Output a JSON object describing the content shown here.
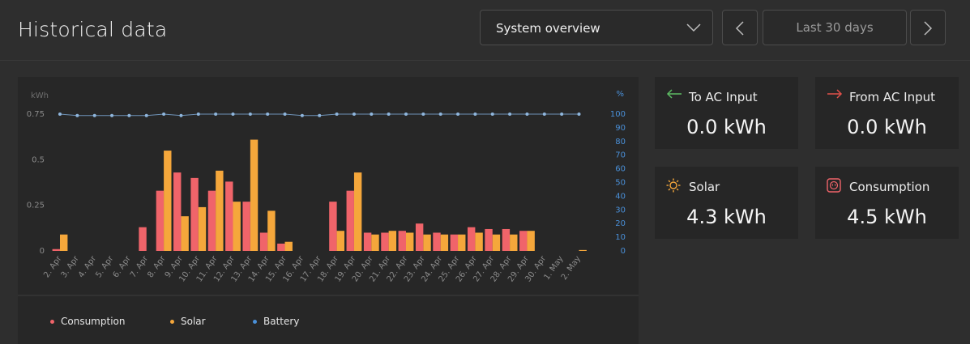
{
  "header": {
    "title": "Historical data",
    "view_select": "System overview",
    "range_label": "Last 30 days"
  },
  "colors": {
    "consumption": "#f0646a",
    "solar": "#f5a73b",
    "battery": "#4a90d9",
    "grid_import": "#5dbb63",
    "grid_export": "#e0504a"
  },
  "icons": {
    "select": "chevron-down-icon",
    "prev": "chevron-left-icon",
    "next": "chevron-right-icon",
    "to_ac": "arrow-left-icon",
    "from_ac": "arrow-right-icon",
    "solar": "sun-icon",
    "consumption": "outlet-icon"
  },
  "cards": {
    "to_ac_input": {
      "label": "To AC Input",
      "value": "0.0 kWh"
    },
    "from_ac_input": {
      "label": "From AC Input",
      "value": "0.0 kWh"
    },
    "solar": {
      "label": "Solar",
      "value": "4.3 kWh"
    },
    "consumption": {
      "label": "Consumption",
      "value": "4.5 kWh"
    }
  },
  "legend": {
    "consumption": "Consumption",
    "solar": "Solar",
    "battery": "Battery"
  },
  "chart_data": {
    "type": "bar",
    "ylabel": "kWh",
    "y2label": "%",
    "ylim": [
      0,
      0.75
    ],
    "y2lim": [
      0,
      100
    ],
    "y_ticks": [
      "0",
      "0.25",
      "0.5",
      "0.75"
    ],
    "y2_ticks": [
      "0",
      "10",
      "20",
      "30",
      "40",
      "50",
      "60",
      "70",
      "80",
      "90",
      "100"
    ],
    "categories": [
      "2. Apr",
      "3. Apr",
      "4. Apr",
      "5. Apr",
      "6. Apr",
      "7. Apr",
      "8. Apr",
      "9. Apr",
      "10. Apr",
      "11. Apr",
      "12. Apr",
      "13. Apr",
      "14. Apr",
      "15. Apr",
      "16. Apr",
      "17. Apr",
      "18. Apr",
      "19. Apr",
      "20. Apr",
      "21. Apr",
      "22. Apr",
      "23. Apr",
      "24. Apr",
      "25. Apr",
      "26. Apr",
      "27. Apr",
      "28. Apr",
      "29. Apr",
      "30. Apr",
      "1. May",
      "2. May"
    ],
    "series": [
      {
        "name": "Consumption",
        "values": [
          0.01,
          0,
          0,
          0,
          0,
          0.13,
          0.33,
          0.43,
          0.4,
          0.33,
          0.38,
          0.27,
          0.1,
          0.04,
          0,
          0,
          0.27,
          0.33,
          0.1,
          0.1,
          0.11,
          0.15,
          0.1,
          0.09,
          0.13,
          0.12,
          0.12,
          0.11,
          0,
          0,
          0
        ]
      },
      {
        "name": "Solar",
        "values": [
          0.09,
          0,
          0,
          0,
          0,
          0,
          0.55,
          0.19,
          0.24,
          0.44,
          0.27,
          0.61,
          0.22,
          0.05,
          0,
          0,
          0.11,
          0.43,
          0.09,
          0.11,
          0.1,
          0.09,
          0.09,
          0.09,
          0.1,
          0.09,
          0.09,
          0.11,
          0,
          0,
          0.005
        ]
      },
      {
        "name": "Battery",
        "values": [
          100,
          99,
          99,
          99,
          99,
          99,
          100,
          99,
          100,
          100,
          100,
          100,
          100,
          100,
          99,
          99,
          100,
          100,
          100,
          100,
          100,
          100,
          100,
          100,
          100,
          100,
          100,
          100,
          100,
          100,
          100
        ]
      }
    ]
  }
}
